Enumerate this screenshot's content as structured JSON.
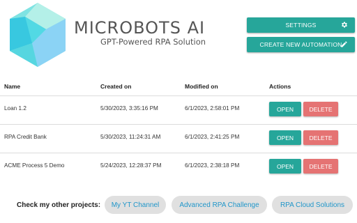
{
  "brand": {
    "name": "MICROBOTS AI",
    "tagline": "GPT-Powered RPA Solution",
    "logo_colors": [
      "#7fe3e3",
      "#38c8e0",
      "#8bd3f5",
      "#b4f0e8"
    ]
  },
  "toolbar": {
    "settings_label": "SETTINGS",
    "settings_icon": "gear-icon",
    "create_label": "CREATE NEW AUTOMATION",
    "create_icon": "pencil-icon"
  },
  "table": {
    "headers": {
      "name": "Name",
      "created": "Created on",
      "modified": "Modified on",
      "actions": "Actions"
    },
    "rows": [
      {
        "name": "Loan 1.2",
        "created": "5/30/2023, 3:35:16 PM",
        "modified": "6/1/2023, 2:58:01 PM",
        "open": "OPEN",
        "delete": "DELETE"
      },
      {
        "name": "RPA Credit Bank",
        "created": "5/30/2023, 11:24:31 AM",
        "modified": "6/1/2023, 2:41:25 PM",
        "open": "OPEN",
        "delete": "DELETE"
      },
      {
        "name": "ACME Process 5 Demo",
        "created": "5/24/2023, 12:28:37 PM",
        "modified": "6/1/2023, 2:38:18 PM",
        "open": "OPEN",
        "delete": "DELETE"
      }
    ]
  },
  "other_projects": {
    "label": "Check my other projects:",
    "links": [
      "My YT Channel",
      "Advanced RPA Challenge",
      "RPA Cloud Solutions"
    ]
  },
  "colors": {
    "accent": "#26a69a",
    "danger": "#e57373",
    "link": "#2196c9",
    "chip_bg": "#e0e0e0"
  }
}
